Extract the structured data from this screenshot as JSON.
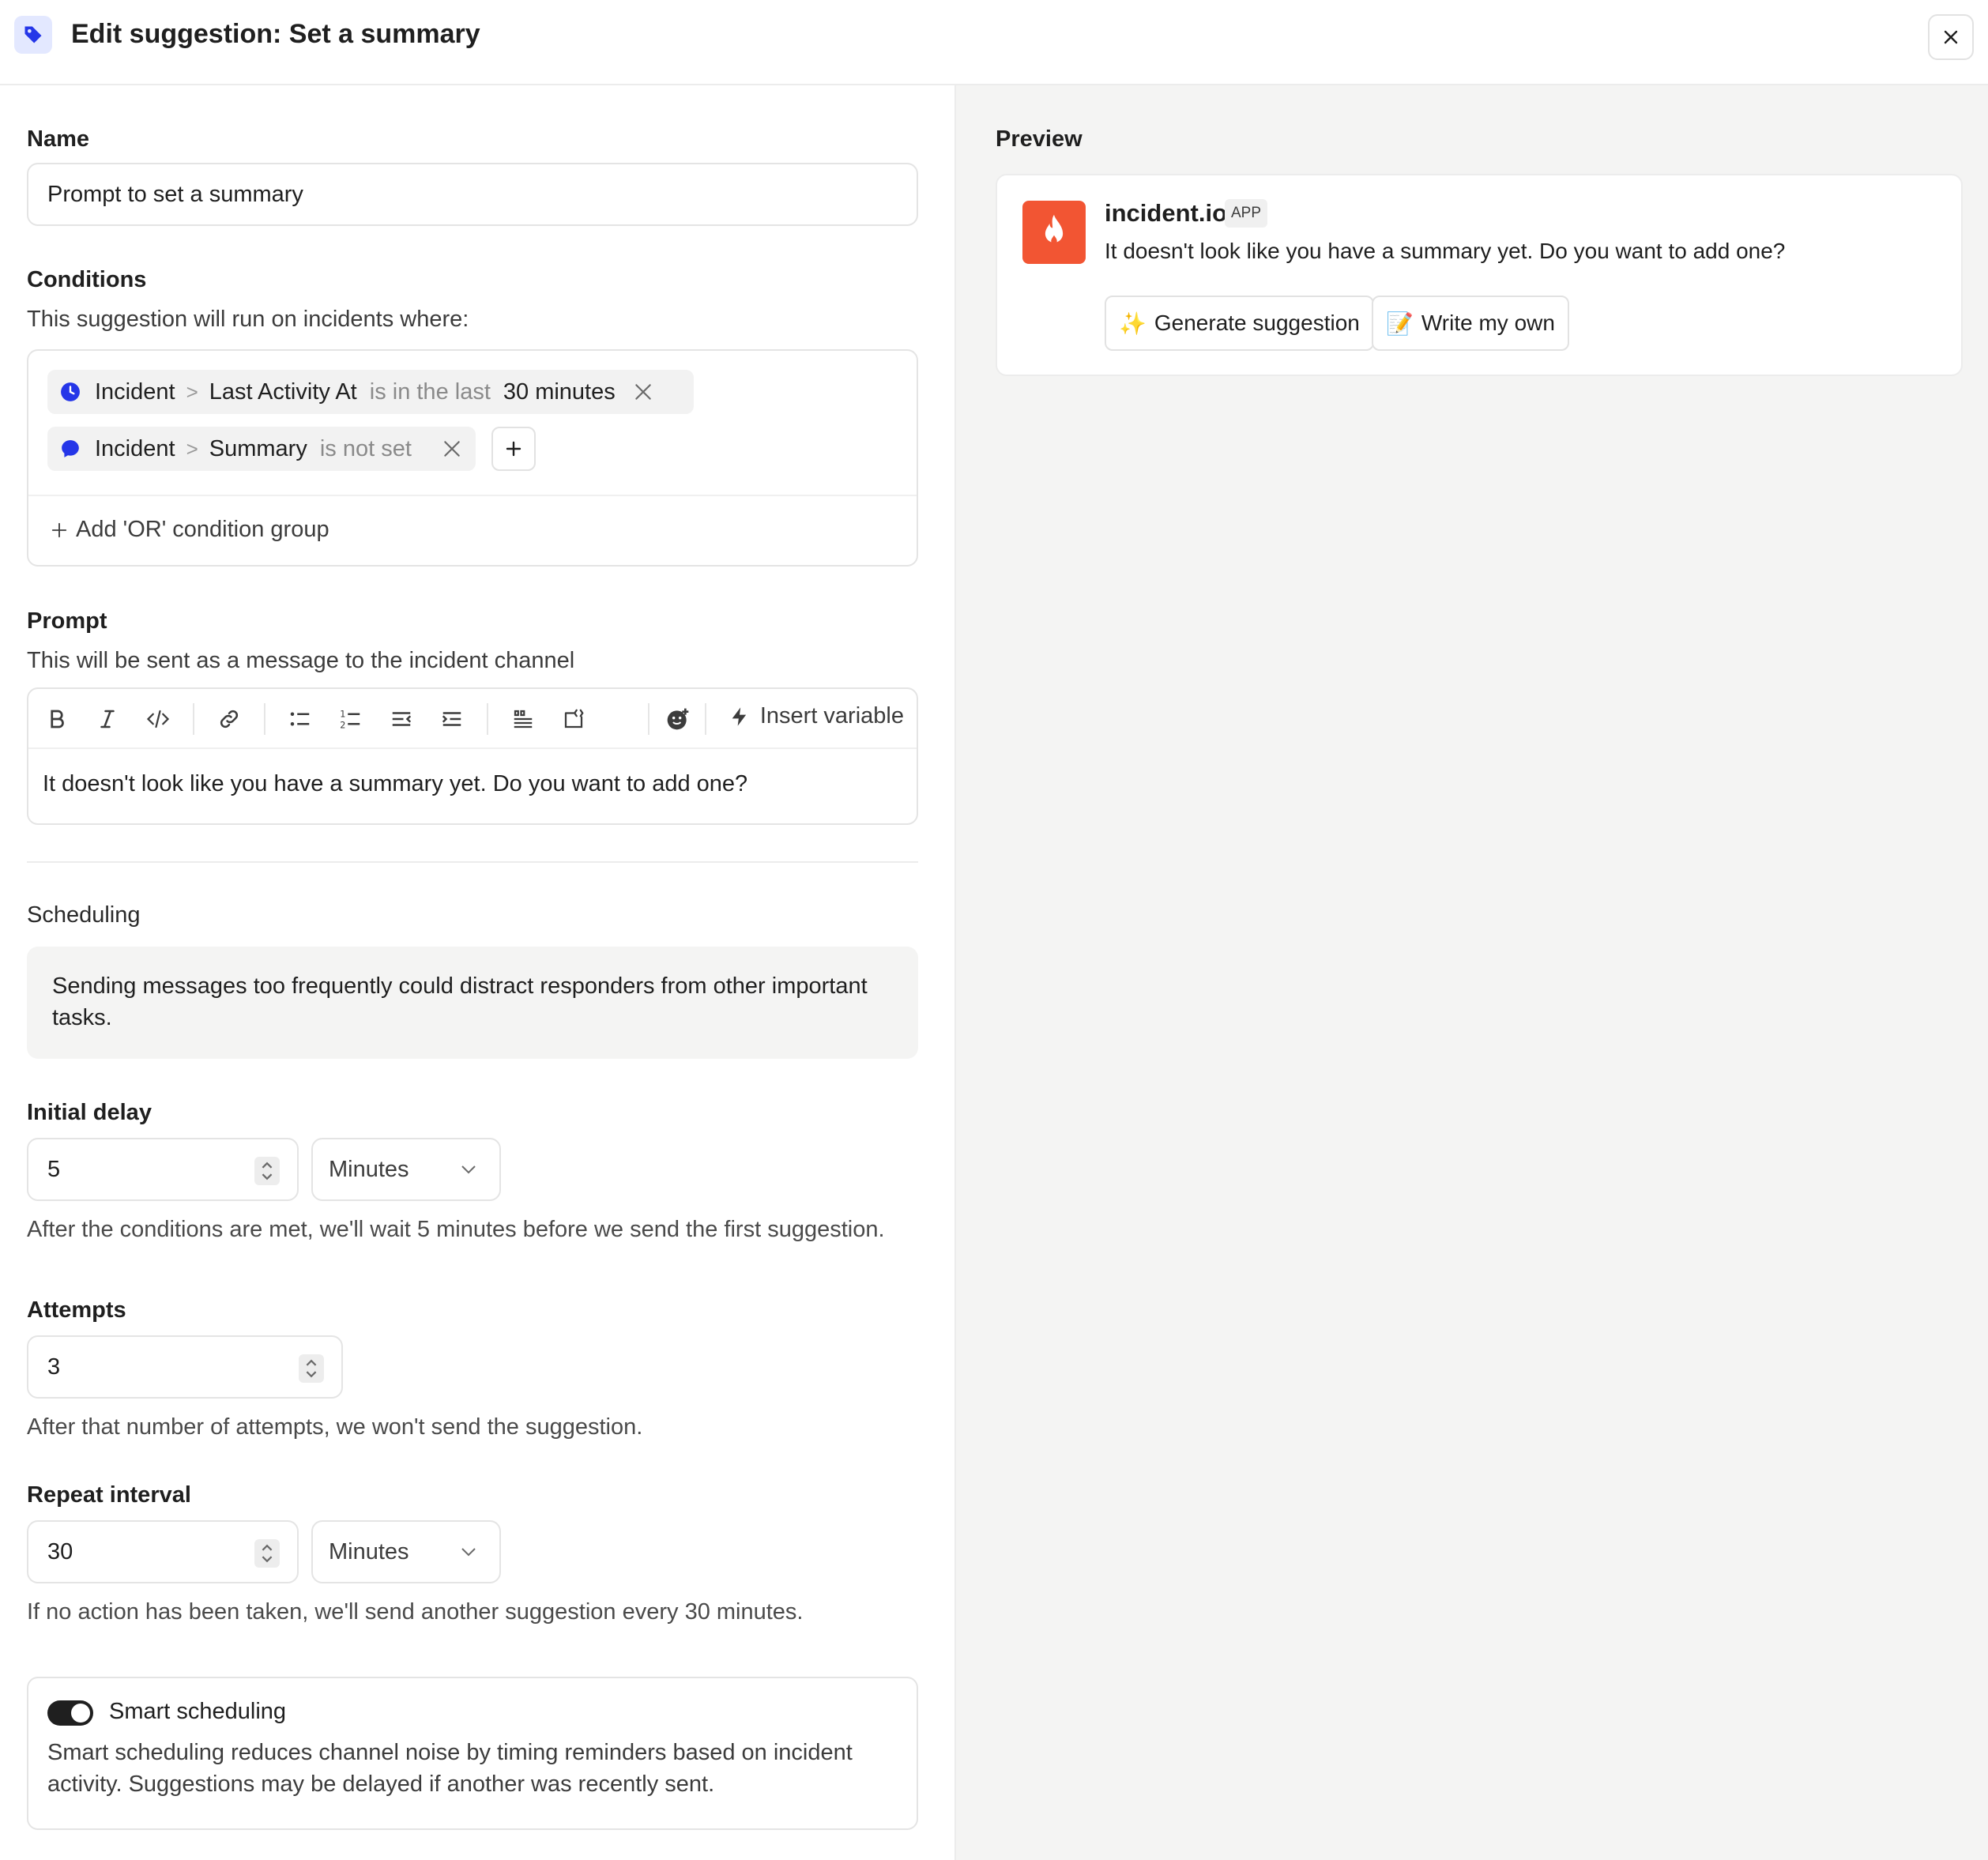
{
  "header": {
    "title": "Edit suggestion: Set a summary"
  },
  "form": {
    "name": {
      "label": "Name",
      "value": "Prompt to set a summary"
    },
    "conditions": {
      "label": "Conditions",
      "subtitle": "This suggestion will run on incidents where:",
      "items": [
        {
          "subject": "Incident",
          "field": "Last Activity At",
          "operator": "is in the last",
          "value": "30 minutes"
        },
        {
          "subject": "Incident",
          "field": "Summary",
          "operator": "is not set",
          "value": ""
        }
      ],
      "add_or": "Add 'OR' condition group"
    },
    "prompt": {
      "label": "Prompt",
      "subtitle": "This will be sent as a message to the incident channel",
      "insert_variable": "Insert variable",
      "text": "It doesn't look like you have a summary yet. Do you want to add one?"
    },
    "scheduling": {
      "label": "Scheduling",
      "warning": "Sending messages too frequently could distract responders from other important tasks."
    },
    "initial_delay": {
      "label": "Initial delay",
      "value": "5",
      "unit": "Minutes",
      "help": "After the conditions are met, we'll wait 5 minutes before we send the first suggestion."
    },
    "attempts": {
      "label": "Attempts",
      "value": "3",
      "help": "After that number of attempts, we won't send the suggestion."
    },
    "repeat_interval": {
      "label": "Repeat interval",
      "value": "30",
      "unit": "Minutes",
      "help": "If no action has been taken, we'll send another suggestion every 30 minutes."
    },
    "smart_scheduling": {
      "title": "Smart scheduling",
      "enabled": true,
      "description": "Smart scheduling reduces channel noise by timing reminders based on incident activity. Suggestions may be delayed if another was recently sent."
    }
  },
  "preview": {
    "label": "Preview",
    "app_name": "incident.io",
    "app_tag": "APP",
    "message": "It doesn't look like you have a summary yet. Do you want to add one?",
    "buttons": [
      {
        "emoji": "✨",
        "label": "Generate suggestion"
      },
      {
        "emoji": "📝",
        "label": "Write my own"
      }
    ]
  },
  "colors": {
    "accent": "#2536e8",
    "brand": "#f25533",
    "toggle_on": "#1f1f1f"
  }
}
